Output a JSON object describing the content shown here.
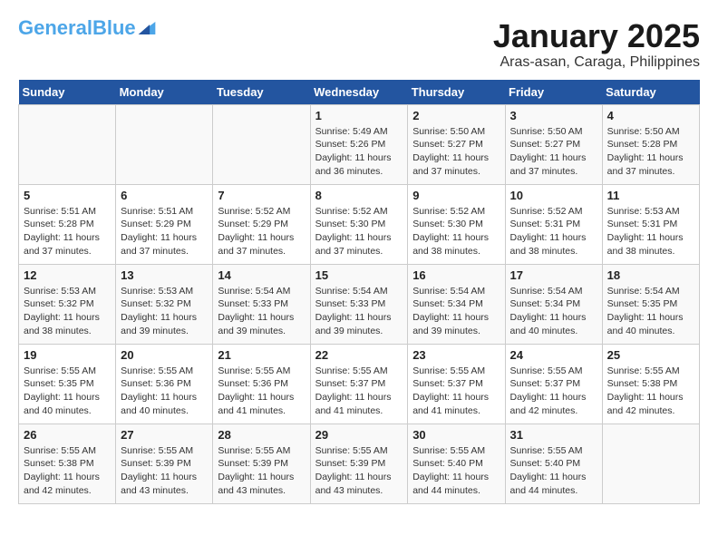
{
  "header": {
    "logo_general": "General",
    "logo_blue": "Blue",
    "month_title": "January 2025",
    "location": "Aras-asan, Caraga, Philippines"
  },
  "days_of_week": [
    "Sunday",
    "Monday",
    "Tuesday",
    "Wednesday",
    "Thursday",
    "Friday",
    "Saturday"
  ],
  "weeks": [
    [
      {
        "day": "",
        "sunrise": "",
        "sunset": "",
        "daylight": ""
      },
      {
        "day": "",
        "sunrise": "",
        "sunset": "",
        "daylight": ""
      },
      {
        "day": "",
        "sunrise": "",
        "sunset": "",
        "daylight": ""
      },
      {
        "day": "1",
        "sunrise": "Sunrise: 5:49 AM",
        "sunset": "Sunset: 5:26 PM",
        "daylight": "Daylight: 11 hours and 36 minutes."
      },
      {
        "day": "2",
        "sunrise": "Sunrise: 5:50 AM",
        "sunset": "Sunset: 5:27 PM",
        "daylight": "Daylight: 11 hours and 37 minutes."
      },
      {
        "day": "3",
        "sunrise": "Sunrise: 5:50 AM",
        "sunset": "Sunset: 5:27 PM",
        "daylight": "Daylight: 11 hours and 37 minutes."
      },
      {
        "day": "4",
        "sunrise": "Sunrise: 5:50 AM",
        "sunset": "Sunset: 5:28 PM",
        "daylight": "Daylight: 11 hours and 37 minutes."
      }
    ],
    [
      {
        "day": "5",
        "sunrise": "Sunrise: 5:51 AM",
        "sunset": "Sunset: 5:28 PM",
        "daylight": "Daylight: 11 hours and 37 minutes."
      },
      {
        "day": "6",
        "sunrise": "Sunrise: 5:51 AM",
        "sunset": "Sunset: 5:29 PM",
        "daylight": "Daylight: 11 hours and 37 minutes."
      },
      {
        "day": "7",
        "sunrise": "Sunrise: 5:52 AM",
        "sunset": "Sunset: 5:29 PM",
        "daylight": "Daylight: 11 hours and 37 minutes."
      },
      {
        "day": "8",
        "sunrise": "Sunrise: 5:52 AM",
        "sunset": "Sunset: 5:30 PM",
        "daylight": "Daylight: 11 hours and 37 minutes."
      },
      {
        "day": "9",
        "sunrise": "Sunrise: 5:52 AM",
        "sunset": "Sunset: 5:30 PM",
        "daylight": "Daylight: 11 hours and 38 minutes."
      },
      {
        "day": "10",
        "sunrise": "Sunrise: 5:52 AM",
        "sunset": "Sunset: 5:31 PM",
        "daylight": "Daylight: 11 hours and 38 minutes."
      },
      {
        "day": "11",
        "sunrise": "Sunrise: 5:53 AM",
        "sunset": "Sunset: 5:31 PM",
        "daylight": "Daylight: 11 hours and 38 minutes."
      }
    ],
    [
      {
        "day": "12",
        "sunrise": "Sunrise: 5:53 AM",
        "sunset": "Sunset: 5:32 PM",
        "daylight": "Daylight: 11 hours and 38 minutes."
      },
      {
        "day": "13",
        "sunrise": "Sunrise: 5:53 AM",
        "sunset": "Sunset: 5:32 PM",
        "daylight": "Daylight: 11 hours and 39 minutes."
      },
      {
        "day": "14",
        "sunrise": "Sunrise: 5:54 AM",
        "sunset": "Sunset: 5:33 PM",
        "daylight": "Daylight: 11 hours and 39 minutes."
      },
      {
        "day": "15",
        "sunrise": "Sunrise: 5:54 AM",
        "sunset": "Sunset: 5:33 PM",
        "daylight": "Daylight: 11 hours and 39 minutes."
      },
      {
        "day": "16",
        "sunrise": "Sunrise: 5:54 AM",
        "sunset": "Sunset: 5:34 PM",
        "daylight": "Daylight: 11 hours and 39 minutes."
      },
      {
        "day": "17",
        "sunrise": "Sunrise: 5:54 AM",
        "sunset": "Sunset: 5:34 PM",
        "daylight": "Daylight: 11 hours and 40 minutes."
      },
      {
        "day": "18",
        "sunrise": "Sunrise: 5:54 AM",
        "sunset": "Sunset: 5:35 PM",
        "daylight": "Daylight: 11 hours and 40 minutes."
      }
    ],
    [
      {
        "day": "19",
        "sunrise": "Sunrise: 5:55 AM",
        "sunset": "Sunset: 5:35 PM",
        "daylight": "Daylight: 11 hours and 40 minutes."
      },
      {
        "day": "20",
        "sunrise": "Sunrise: 5:55 AM",
        "sunset": "Sunset: 5:36 PM",
        "daylight": "Daylight: 11 hours and 40 minutes."
      },
      {
        "day": "21",
        "sunrise": "Sunrise: 5:55 AM",
        "sunset": "Sunset: 5:36 PM",
        "daylight": "Daylight: 11 hours and 41 minutes."
      },
      {
        "day": "22",
        "sunrise": "Sunrise: 5:55 AM",
        "sunset": "Sunset: 5:37 PM",
        "daylight": "Daylight: 11 hours and 41 minutes."
      },
      {
        "day": "23",
        "sunrise": "Sunrise: 5:55 AM",
        "sunset": "Sunset: 5:37 PM",
        "daylight": "Daylight: 11 hours and 41 minutes."
      },
      {
        "day": "24",
        "sunrise": "Sunrise: 5:55 AM",
        "sunset": "Sunset: 5:37 PM",
        "daylight": "Daylight: 11 hours and 42 minutes."
      },
      {
        "day": "25",
        "sunrise": "Sunrise: 5:55 AM",
        "sunset": "Sunset: 5:38 PM",
        "daylight": "Daylight: 11 hours and 42 minutes."
      }
    ],
    [
      {
        "day": "26",
        "sunrise": "Sunrise: 5:55 AM",
        "sunset": "Sunset: 5:38 PM",
        "daylight": "Daylight: 11 hours and 42 minutes."
      },
      {
        "day": "27",
        "sunrise": "Sunrise: 5:55 AM",
        "sunset": "Sunset: 5:39 PM",
        "daylight": "Daylight: 11 hours and 43 minutes."
      },
      {
        "day": "28",
        "sunrise": "Sunrise: 5:55 AM",
        "sunset": "Sunset: 5:39 PM",
        "daylight": "Daylight: 11 hours and 43 minutes."
      },
      {
        "day": "29",
        "sunrise": "Sunrise: 5:55 AM",
        "sunset": "Sunset: 5:39 PM",
        "daylight": "Daylight: 11 hours and 43 minutes."
      },
      {
        "day": "30",
        "sunrise": "Sunrise: 5:55 AM",
        "sunset": "Sunset: 5:40 PM",
        "daylight": "Daylight: 11 hours and 44 minutes."
      },
      {
        "day": "31",
        "sunrise": "Sunrise: 5:55 AM",
        "sunset": "Sunset: 5:40 PM",
        "daylight": "Daylight: 11 hours and 44 minutes."
      },
      {
        "day": "",
        "sunrise": "",
        "sunset": "",
        "daylight": ""
      }
    ]
  ]
}
